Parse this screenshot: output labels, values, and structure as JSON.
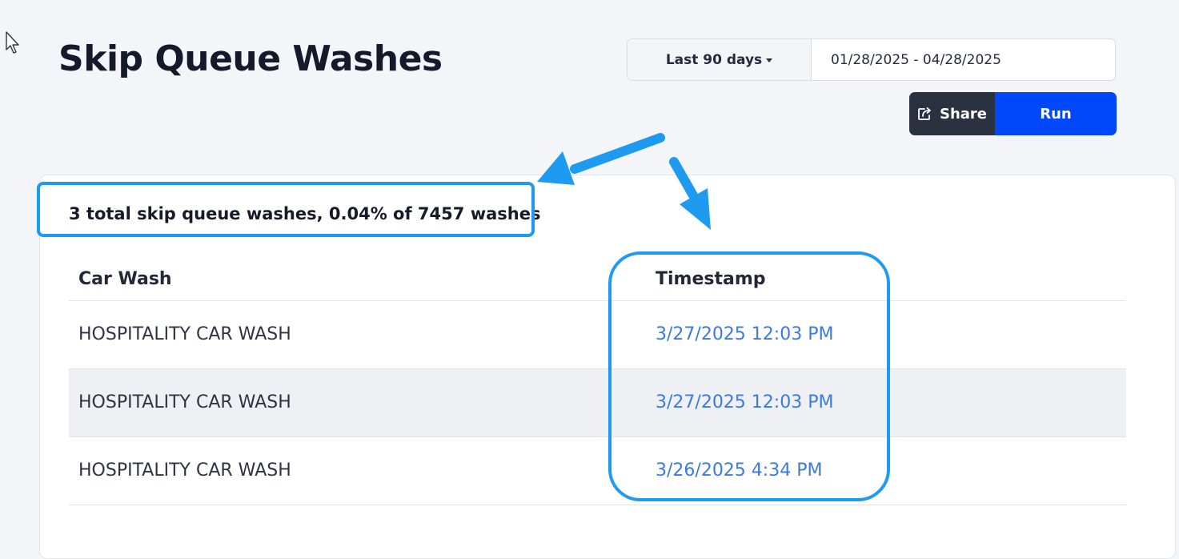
{
  "page": {
    "title": "Skip Queue Washes"
  },
  "filters": {
    "range_label": "Last 90 days",
    "date_range_value": "01/28/2025 - 04/28/2025"
  },
  "actions": {
    "share_label": "Share",
    "run_label": "Run"
  },
  "summary": {
    "text": "3 total skip queue washes, 0.04% of 7457 washes"
  },
  "table": {
    "headers": [
      "Car Wash",
      "Timestamp"
    ],
    "rows": [
      {
        "car_wash": "HOSPITALITY CAR WASH",
        "timestamp": "3/27/2025 12:03 PM"
      },
      {
        "car_wash": "HOSPITALITY CAR WASH",
        "timestamp": "3/27/2025 12:03 PM"
      },
      {
        "car_wash": "HOSPITALITY CAR WASH",
        "timestamp": "3/26/2025 4:34 PM"
      }
    ]
  },
  "icons": {
    "share": "share-icon",
    "cursor": "mouse-cursor-icon",
    "dropdown": "caret-down-icon"
  },
  "colors": {
    "run_button": "#0248fb",
    "share_button": "#2a3140",
    "annotation": "#1e9bf0",
    "timestamp_link": "#3b7ae6"
  }
}
